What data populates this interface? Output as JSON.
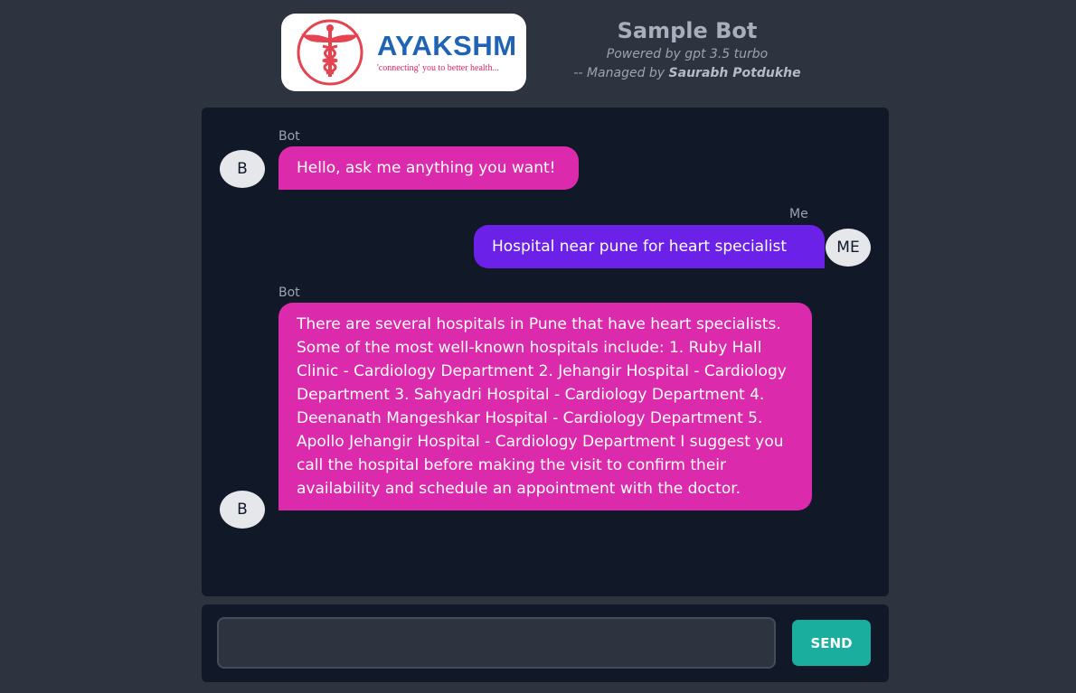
{
  "logo": {
    "name": "AYAKSHM",
    "tagline": "'connecting' you to better health..."
  },
  "header": {
    "title": "Sample Bot",
    "powered_by": "Powered by gpt 3.5 turbo",
    "managed_prefix": "-- Managed by",
    "manager_name": "Saurabh Potdukhe"
  },
  "messages": [
    {
      "sender": "Bot",
      "avatar": "B",
      "text": "Hello, ask me anything you want!"
    },
    {
      "sender": "Me",
      "avatar": "ME",
      "text": "Hospital near pune for heart specialist"
    },
    {
      "sender": "Bot",
      "avatar": "B",
      "text": "There are several hospitals in Pune that have heart specialists. Some of the most well-known hospitals include: 1. Ruby Hall Clinic - Cardiology Department 2. Jehangir Hospital - Cardiology Department 3. Sahyadri Hospital - Cardiology Department 4. Deenanath Mangeshkar Hospital - Cardiology Department 5. Apollo Jehangir Hospital - Cardiology Department I suggest you call the hospital before making the visit to confirm their availability and schedule an appointment with the doctor."
    }
  ],
  "input": {
    "value": "",
    "send_label": "SEND"
  },
  "colors": {
    "page_bg": "#2d333f",
    "panel_bg": "#111827",
    "bot_bubble": "#db2aac",
    "user_bubble": "#6b21e8",
    "send_button": "#1aae9f",
    "logo_blue": "#1f63b5",
    "logo_red": "#e5434f"
  }
}
